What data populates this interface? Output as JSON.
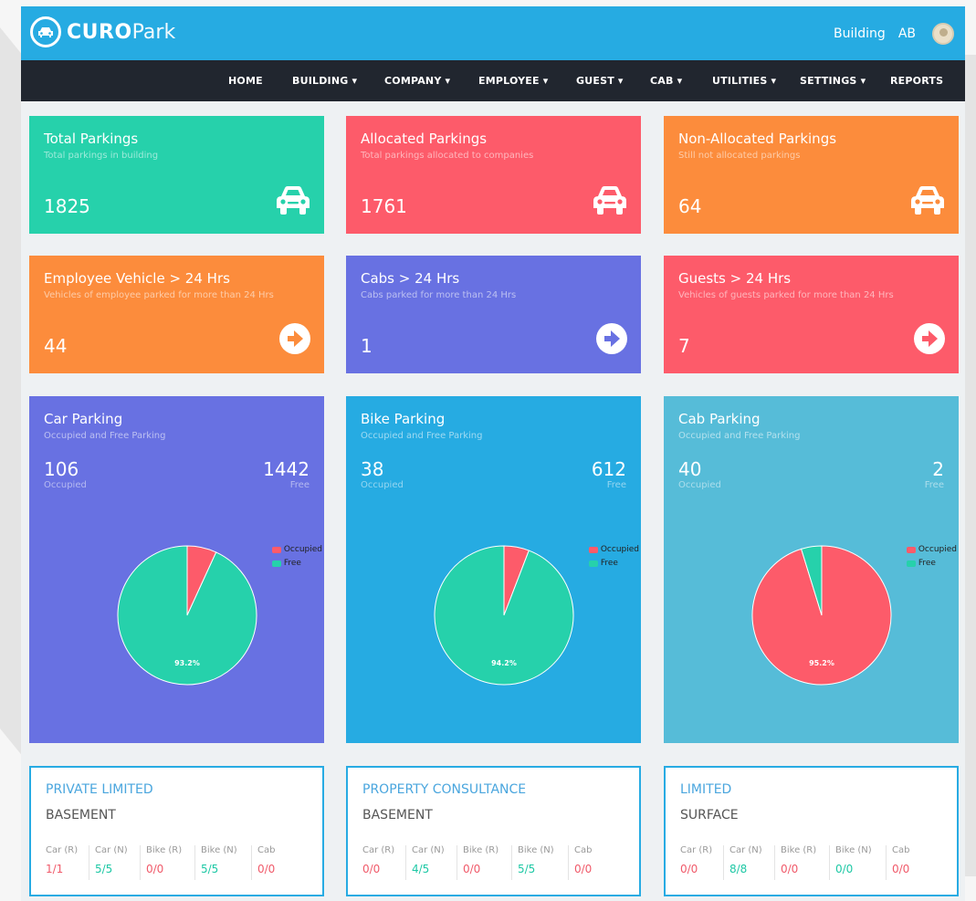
{
  "app": {
    "name_bold": "CURO",
    "name_light": "Park"
  },
  "header": {
    "building": "Building",
    "user": "AB"
  },
  "nav": [
    "HOME",
    "BUILDING ▾",
    "COMPANY ▾",
    "EMPLOYEE ▾",
    "GUEST ▾",
    "CAB ▾",
    "UTILITIES ▾",
    "SETTINGS ▾",
    "REPORTS"
  ],
  "stats": [
    {
      "title": "Total Parkings",
      "subtitle": "Total parkings in building",
      "value": "1825",
      "color": "#26d1ab",
      "icon": "car-icon"
    },
    {
      "title": "Allocated Parkings",
      "subtitle": "Total parkings allocated to companies",
      "value": "1761",
      "color": "#fd5b6a",
      "icon": "car-icon"
    },
    {
      "title": "Non-Allocated Parkings",
      "subtitle": "Still not allocated parkings",
      "value": "64",
      "color": "#fc8c3c",
      "icon": "car-icon"
    },
    {
      "title": "Employee Vehicle > 24 Hrs",
      "subtitle": "Vehicles of employee parked for more than 24 Hrs",
      "value": "44",
      "color": "#fc8c3c",
      "icon": "arrow-right-circle-icon"
    },
    {
      "title": "Cabs > 24 Hrs",
      "subtitle": "Cabs parked for more than 24 Hrs",
      "value": "1",
      "color": "#6871e2",
      "icon": "arrow-right-circle-icon"
    },
    {
      "title": "Guests > 24 Hrs",
      "subtitle": "Vehicles of guests parked for more than 24 Hrs",
      "value": "7",
      "color": "#fd5b6a",
      "icon": "arrow-right-circle-icon"
    }
  ],
  "pies": [
    {
      "title": "Car Parking",
      "subtitle": "Occupied and Free Parking",
      "occupied": "106",
      "occupied_label": "Occupied",
      "free": "1442",
      "free_label": "Free",
      "color": "#6871e2",
      "legend": [
        "Occupied",
        "Free"
      ],
      "pct_label": "93.2%"
    },
    {
      "title": "Bike Parking",
      "subtitle": "Occupied and Free Parking",
      "occupied": "38",
      "occupied_label": "Occupied",
      "free": "612",
      "free_label": "Free",
      "color": "#26abe2",
      "legend": [
        "Occupied",
        "Free"
      ],
      "pct_label": "94.2%"
    },
    {
      "title": "Cab Parking",
      "subtitle": "Occupied and Free Parking",
      "occupied": "40",
      "occupied_label": "Occupied",
      "free": "2",
      "free_label": "Free",
      "color": "#56bcd8",
      "legend": [
        "Occupied",
        "Free"
      ],
      "pct_label": "95.2%"
    }
  ],
  "chart_data": [
    {
      "type": "pie",
      "title": "Car Parking",
      "categories": [
        "Occupied",
        "Free"
      ],
      "values": [
        106,
        1442
      ],
      "colors": [
        "#fd5b6a",
        "#26d1ab"
      ],
      "legend": "top-right",
      "data_labels": [
        "",
        "93.2%"
      ]
    },
    {
      "type": "pie",
      "title": "Bike Parking",
      "categories": [
        "Occupied",
        "Free"
      ],
      "values": [
        38,
        612
      ],
      "colors": [
        "#fd5b6a",
        "#26d1ab"
      ],
      "legend": "top-right",
      "data_labels": [
        "",
        "94.2%"
      ]
    },
    {
      "type": "pie",
      "title": "Cab Parking",
      "categories": [
        "Occupied",
        "Free"
      ],
      "values": [
        40,
        2
      ],
      "colors": [
        "#fd5b6a",
        "#26d1ab"
      ],
      "legend": "top-right",
      "data_labels": [
        "95.2%",
        ""
      ]
    }
  ],
  "companies": [
    {
      "name": "PRIVATE LIMITED",
      "location": "BASEMENT",
      "columns": [
        {
          "h": "Car (R)",
          "v": "1/1"
        },
        {
          "h": "Car (N)",
          "v": "5/5"
        },
        {
          "h": "Bike (R)",
          "v": "0/0"
        },
        {
          "h": "Bike (N)",
          "v": "5/5"
        },
        {
          "h": "Cab",
          "v": "0/0"
        }
      ]
    },
    {
      "name": "PROPERTY CONSULTANCE",
      "location": "BASEMENT",
      "columns": [
        {
          "h": "Car (R)",
          "v": "0/0"
        },
        {
          "h": "Car (N)",
          "v": "4/5"
        },
        {
          "h": "Bike (R)",
          "v": "0/0"
        },
        {
          "h": "Bike (N)",
          "v": "5/5"
        },
        {
          "h": "Cab",
          "v": "0/0"
        }
      ]
    },
    {
      "name": "LIMITED",
      "location": "SURFACE",
      "columns": [
        {
          "h": "Car (R)",
          "v": "0/0"
        },
        {
          "h": "Car (N)",
          "v": "8/8"
        },
        {
          "h": "Bike (R)",
          "v": "0/0"
        },
        {
          "h": "Bike (N)",
          "v": "0/0"
        },
        {
          "h": "Cab",
          "v": "0/0"
        }
      ]
    }
  ]
}
